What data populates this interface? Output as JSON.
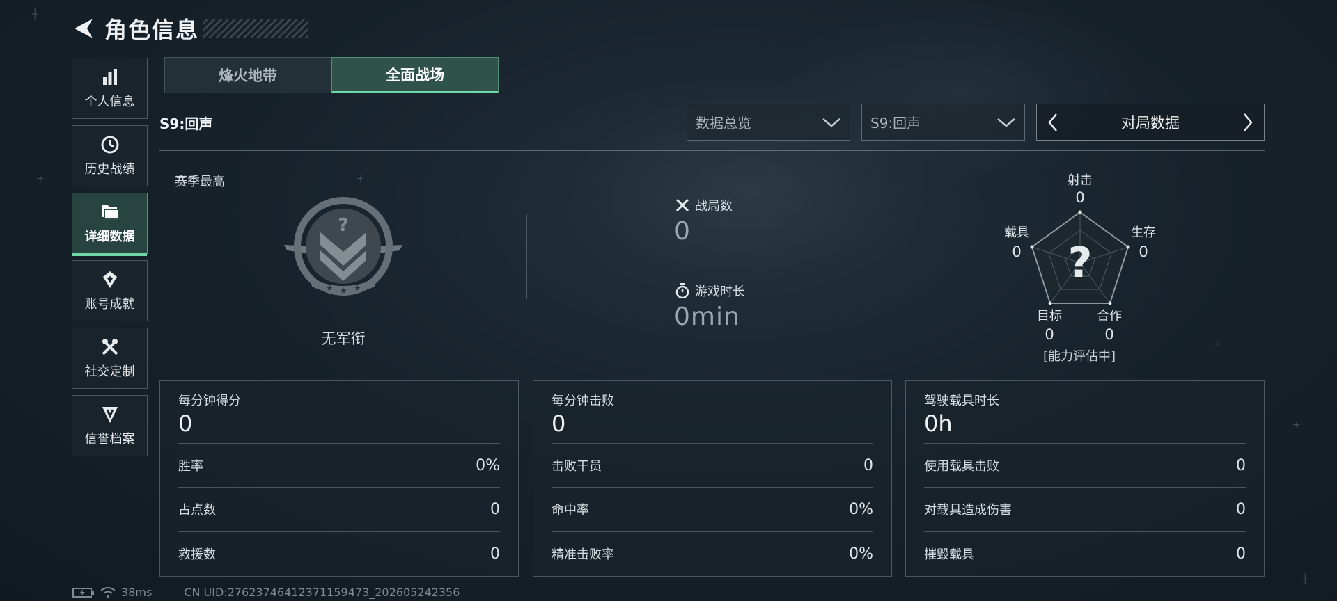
{
  "header": {
    "title": "角色信息"
  },
  "sidebar": {
    "items": [
      {
        "label": "个人信息",
        "icon": "bar-chart-icon"
      },
      {
        "label": "历史战绩",
        "icon": "history-icon"
      },
      {
        "label": "详细数据",
        "icon": "folder-icon",
        "active": true
      },
      {
        "label": "账号成就",
        "icon": "achievement-icon"
      },
      {
        "label": "社交定制",
        "icon": "tools-icon"
      },
      {
        "label": "信誉档案",
        "icon": "shield-icon"
      }
    ]
  },
  "mode_tabs": [
    {
      "label": "烽火地带",
      "active": false
    },
    {
      "label": "全面战场",
      "active": true
    }
  ],
  "season": {
    "label": "S9:回声"
  },
  "filters": {
    "overview_dropdown": "数据总览",
    "season_dropdown": "S9:回声",
    "pager_label": "对局数据"
  },
  "overview": {
    "season_best_label": "赛季最高",
    "rank_name": "无军衔",
    "matches_label": "战局数",
    "matches_value": "0",
    "playtime_label": "游戏时长",
    "playtime_value": "0min"
  },
  "radar": {
    "axes": [
      {
        "label": "射击",
        "value": "0"
      },
      {
        "label": "生存",
        "value": "0"
      },
      {
        "label": "合作",
        "value": "0"
      },
      {
        "label": "目标",
        "value": "0"
      },
      {
        "label": "载具",
        "value": "0"
      }
    ],
    "center_mark": "?",
    "status": "[能力评估中]"
  },
  "cards": [
    {
      "title": "每分钟得分",
      "main_value": "0",
      "rows": [
        {
          "label": "胜率",
          "value": "0%"
        },
        {
          "label": "占点数",
          "value": "0"
        },
        {
          "label": "救援数",
          "value": "0"
        }
      ]
    },
    {
      "title": "每分钟击败",
      "main_value": "0",
      "rows": [
        {
          "label": "击败干员",
          "value": "0"
        },
        {
          "label": "命中率",
          "value": "0%"
        },
        {
          "label": "精准击败率",
          "value": "0%"
        }
      ]
    },
    {
      "title": "驾驶载具时长",
      "main_value": "0h",
      "rows": [
        {
          "label": "使用载具击败",
          "value": "0"
        },
        {
          "label": "对载具造成伤害",
          "value": "0"
        },
        {
          "label": "摧毁载具",
          "value": "0"
        }
      ]
    }
  ],
  "footer": {
    "ping": "38ms",
    "uid": "CN UID:2762374641237115947​3_202605242356"
  },
  "colors": {
    "accent": "#6fd7a8",
    "background": "#17222b"
  }
}
